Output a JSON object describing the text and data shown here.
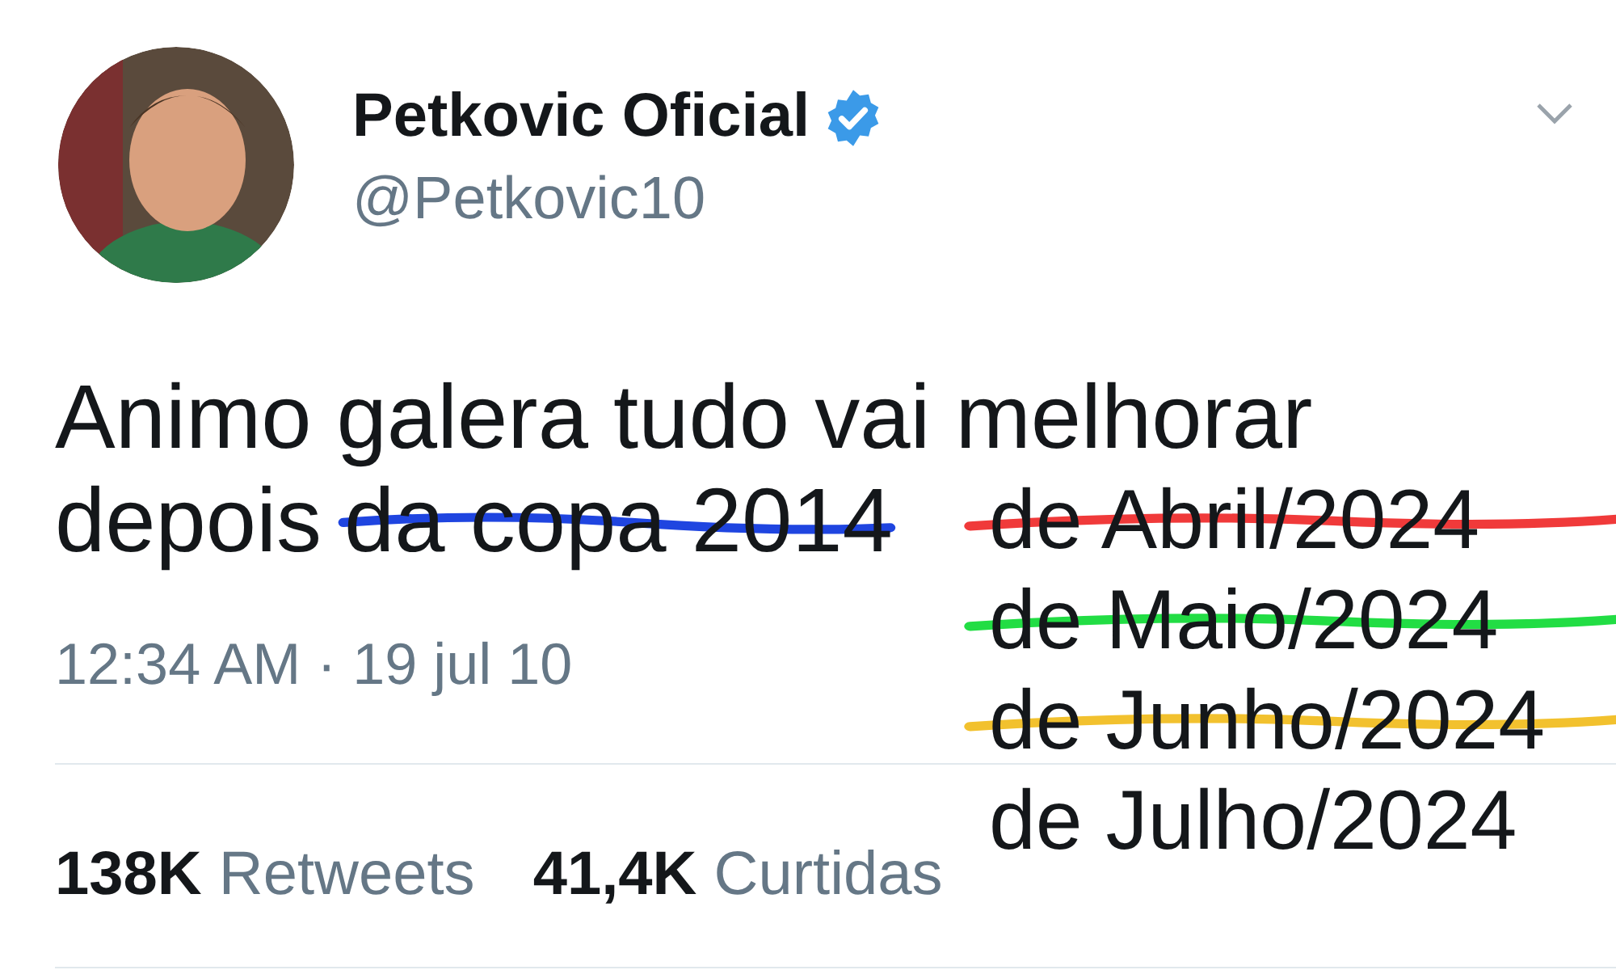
{
  "tweet": {
    "author": {
      "name": "Petkovic Oficial",
      "handle": "@Petkovic10",
      "verified": true
    },
    "text_lines": [
      "Animo galera tudo vai melhorar",
      "depois"
    ],
    "struck_text": {
      "text": "da copa 2014",
      "color": "#1f45e0"
    },
    "edits": [
      {
        "text": "de Abril/2024",
        "struck": true,
        "color": "#f03a3a"
      },
      {
        "text": "de Maio/2024",
        "struck": true,
        "color": "#22dd44"
      },
      {
        "text": "de Junho/2024",
        "struck": true,
        "color": "#f2c12e"
      },
      {
        "text": "de Julho/2024",
        "struck": false
      }
    ],
    "time": "12:34 AM · 19 jul 10",
    "stats": [
      {
        "count": "138K",
        "label": "Retweets"
      },
      {
        "count": "41,4K",
        "label": "Curtidas"
      }
    ]
  }
}
